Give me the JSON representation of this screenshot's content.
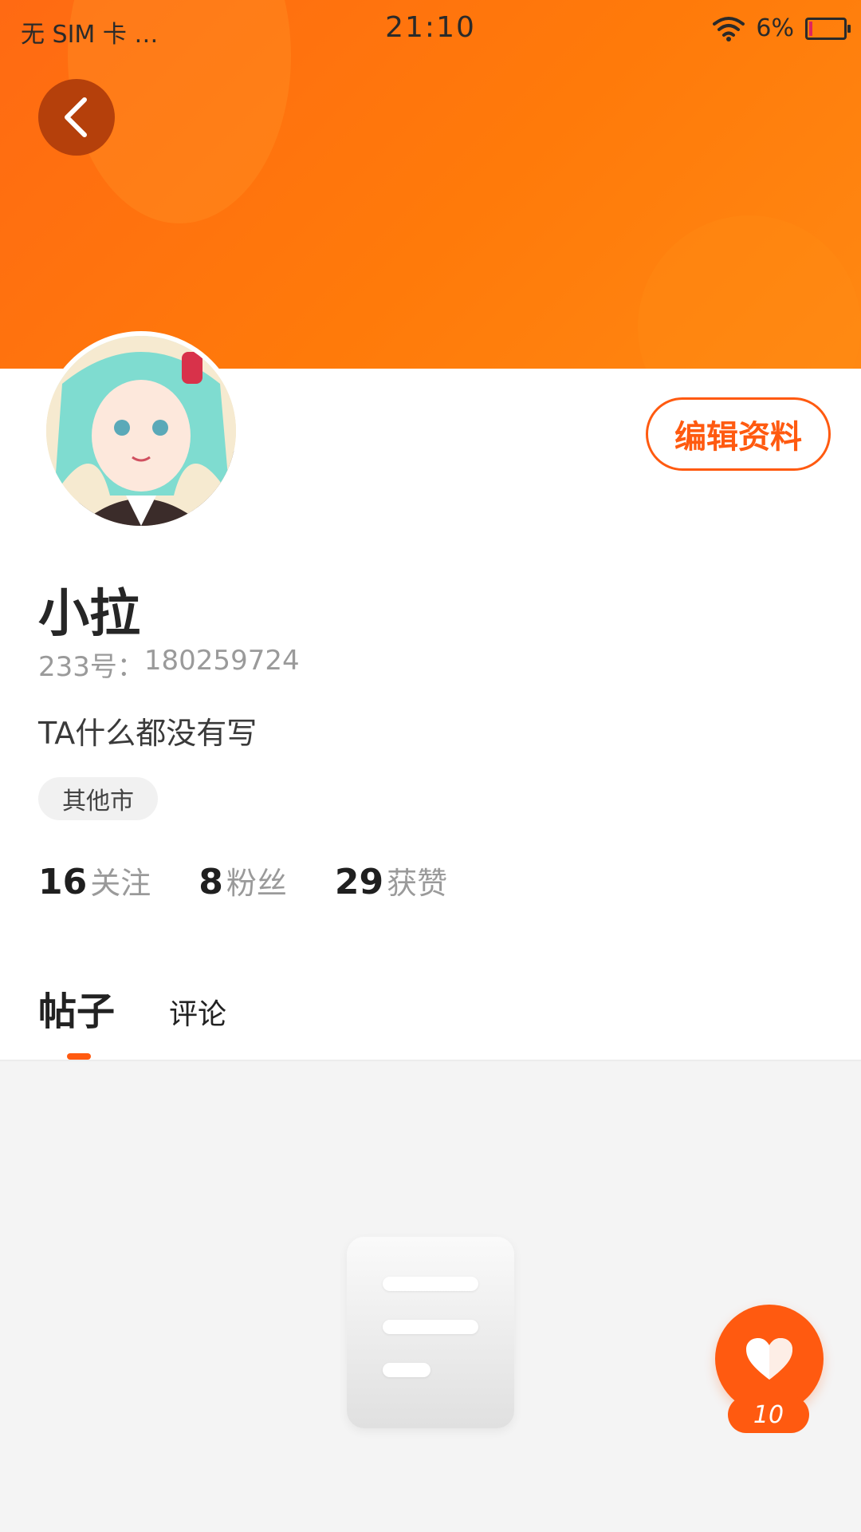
{
  "status_bar": {
    "carrier": "无 SIM 卡 …",
    "time": "21:10",
    "battery_percent": "6%"
  },
  "profile": {
    "edit_label": "编辑资料",
    "username": "小拉",
    "id_label": "233号：",
    "id_value": "180259724",
    "bio": "TA什么都没有写",
    "location": "其他市",
    "stats": [
      {
        "value": "16",
        "label": "关注"
      },
      {
        "value": "8",
        "label": "粉丝"
      },
      {
        "value": "29",
        "label": "获赞"
      }
    ]
  },
  "tabs": [
    {
      "label": "帖子",
      "active": true
    },
    {
      "label": "评论",
      "active": false
    }
  ],
  "like_button": {
    "count": "10",
    "icon": "heart-icon"
  },
  "colors": {
    "accent": "#ff5a10",
    "banner": "#ff7a0a"
  }
}
